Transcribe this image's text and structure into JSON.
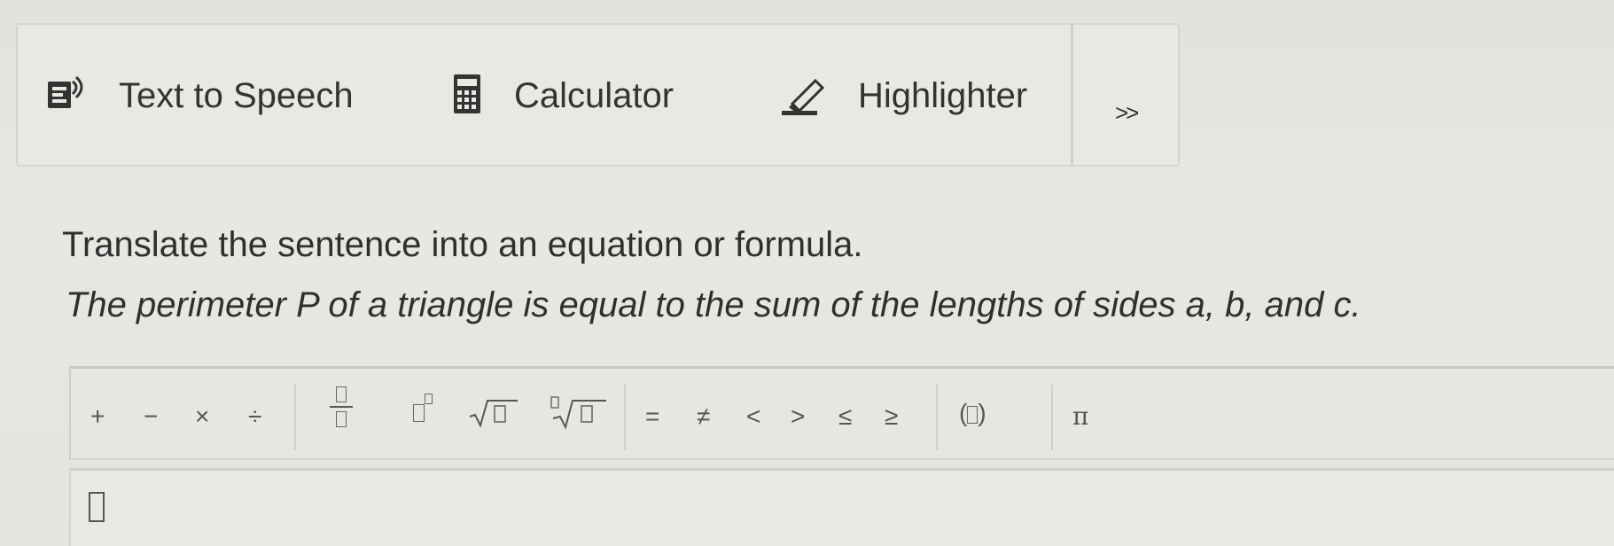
{
  "toolbar": {
    "tools": [
      {
        "label": "Text to Speech",
        "icon": "speaker-icon"
      },
      {
        "label": "Calculator",
        "icon": "calculator-icon"
      },
      {
        "label": "Highlighter",
        "icon": "highlighter-icon"
      }
    ],
    "more_label": ">>"
  },
  "question": {
    "instruction": "Translate the sentence into an equation or formula.",
    "sentence": "The perimeter P of a triangle is equal to the sum of the lengths of sides a, b, and c."
  },
  "palette": {
    "operators": [
      "+",
      "−",
      "×",
      "÷"
    ],
    "relations": [
      "=",
      "≠",
      "<",
      ">",
      "≤",
      "≥"
    ],
    "pi": "π"
  },
  "colors": {
    "background": "#e6e6e1",
    "text": "#2f3030",
    "border": "#d0d0ca"
  }
}
